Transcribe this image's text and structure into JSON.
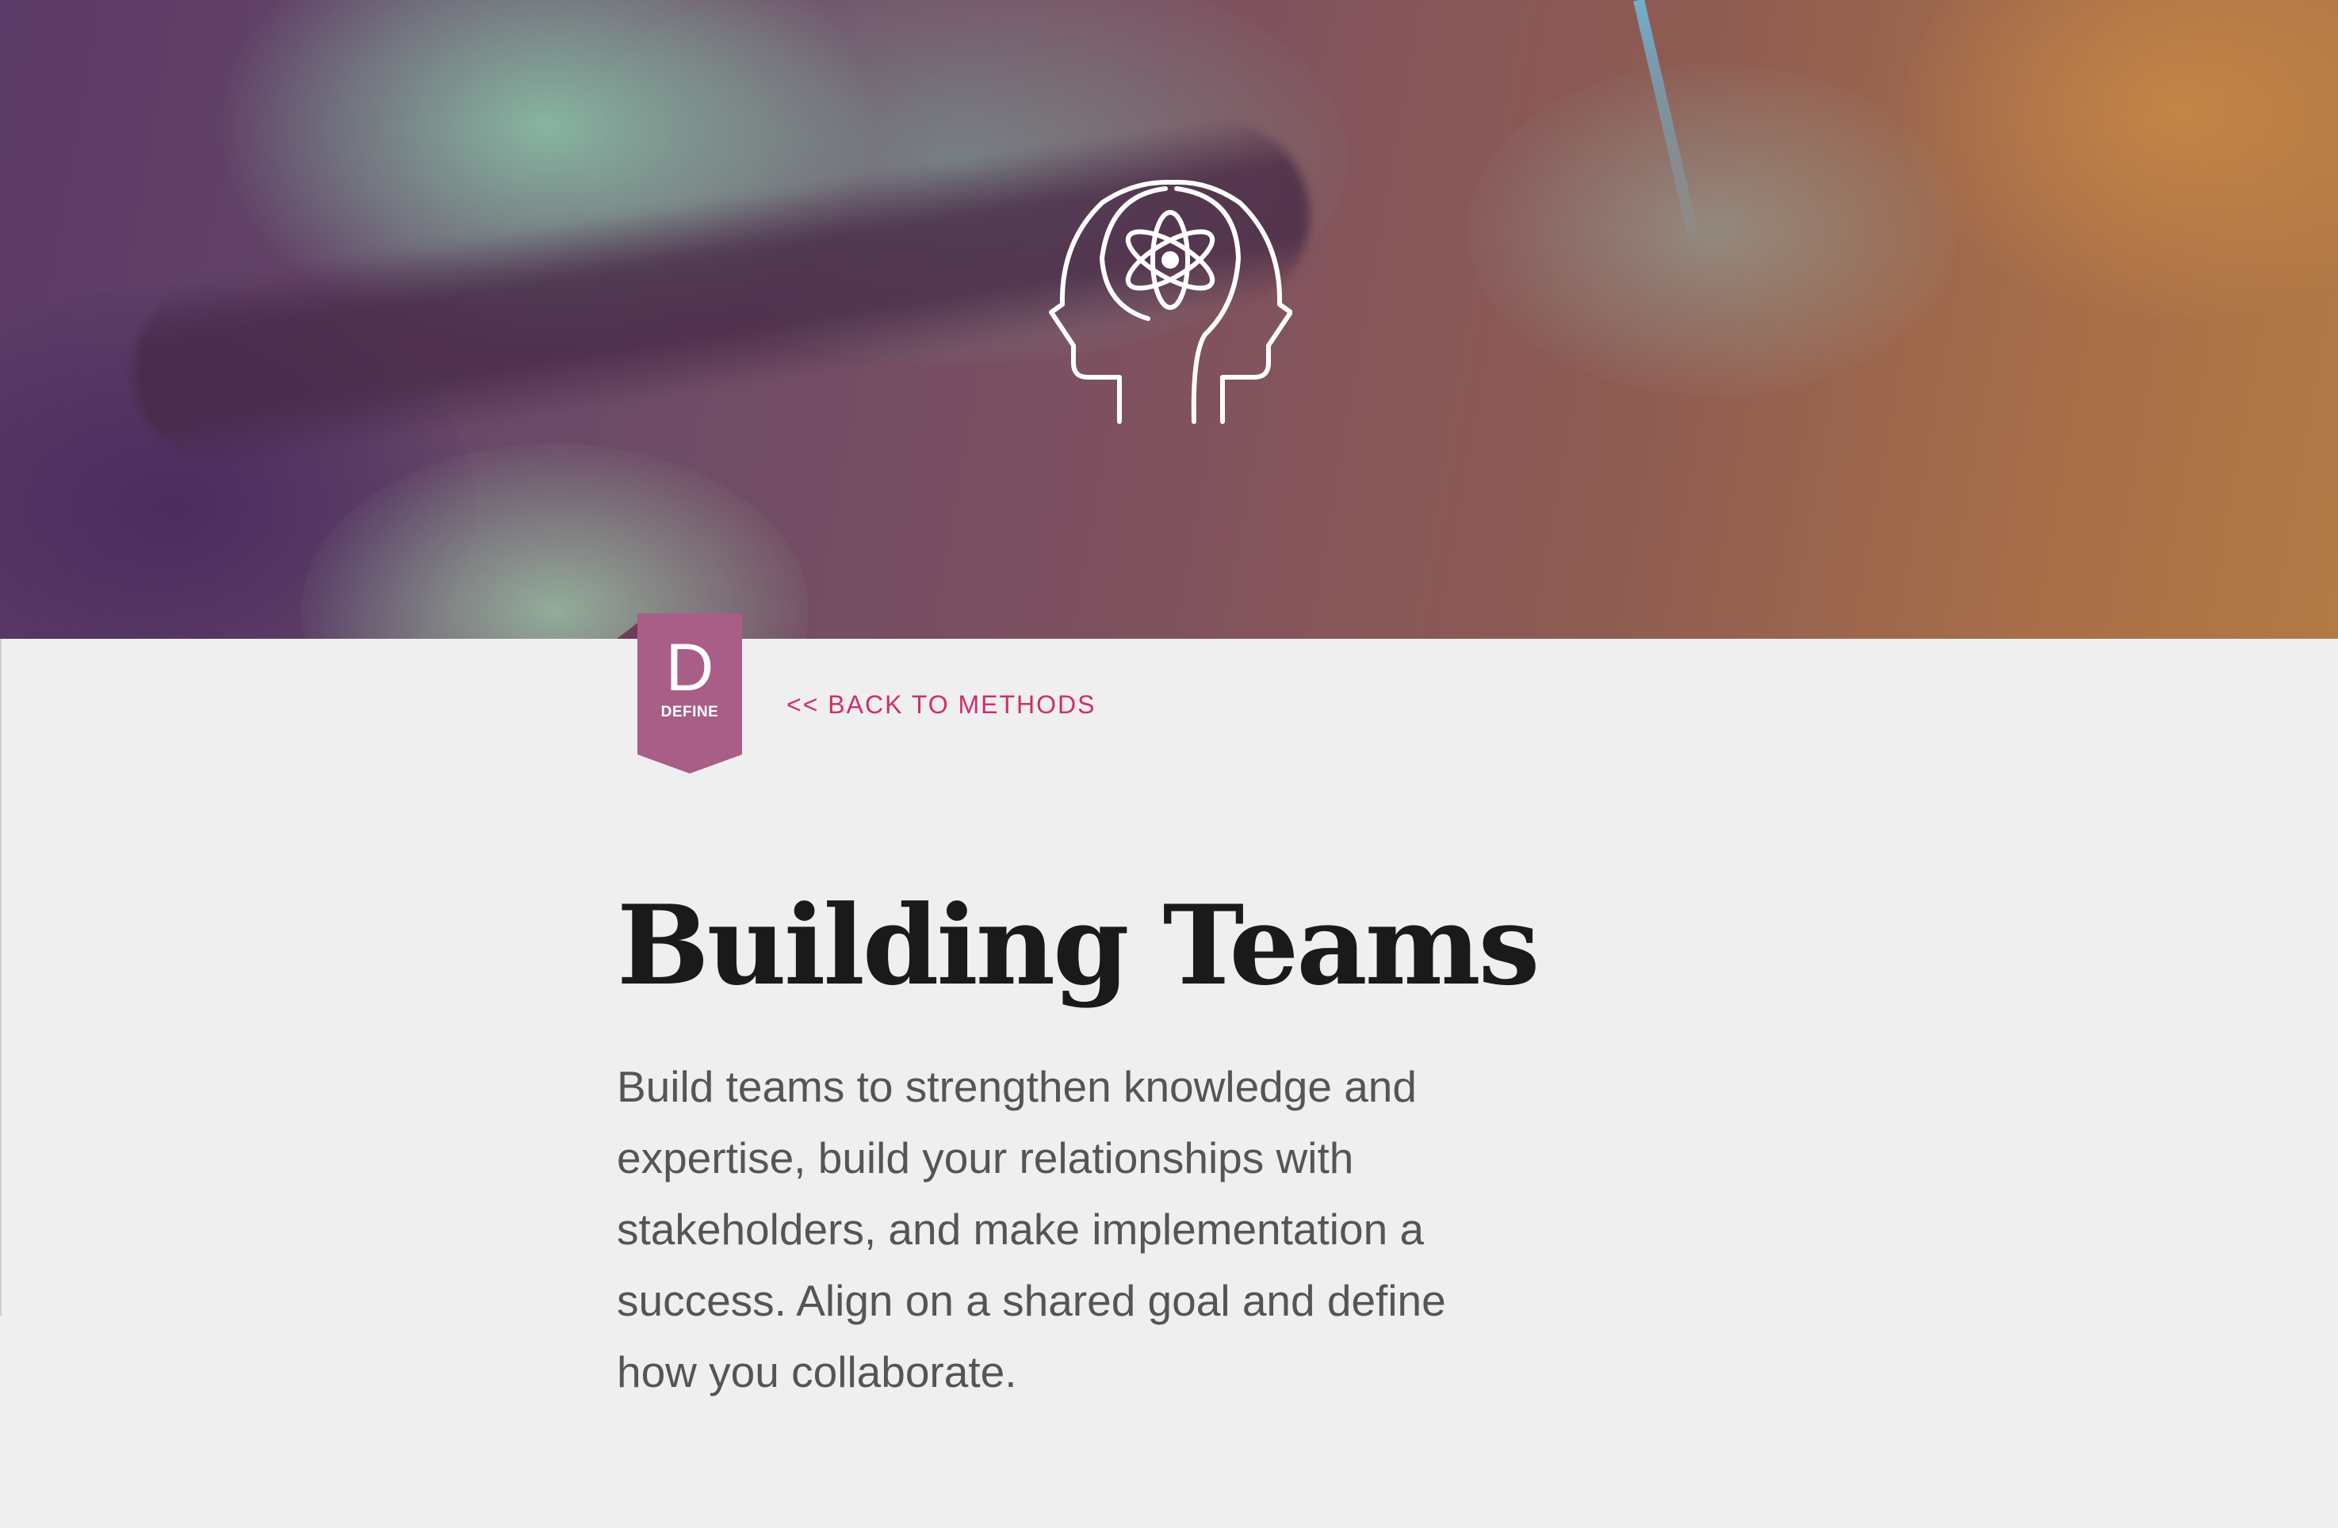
{
  "hero": {
    "icon": "heads-atom-icon"
  },
  "phase_badge": {
    "letter": "D",
    "label": "DEFINE",
    "color": "#a85e87"
  },
  "nav": {
    "back_label": "<< BACK TO METHODS",
    "link_color": "#cd2f6e"
  },
  "main": {
    "title": "Building Teams",
    "description": "Build teams to strengthen knowledge and expertise, build your relationships with stakeholders, and make implementation a success. Align on a shared goal and define how you collaborate."
  }
}
